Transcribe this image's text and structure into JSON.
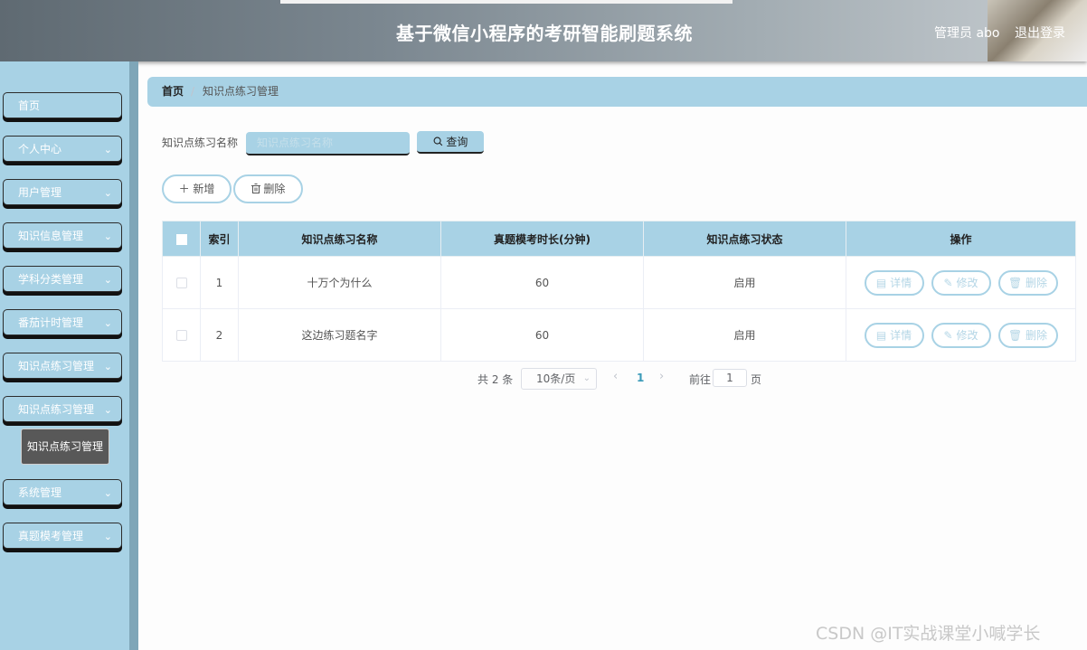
{
  "header": {
    "title": "基于微信小程序的考研智能刷题系统",
    "admin_label": "管理员 abo",
    "logout_label": "退出登录"
  },
  "sidebar": {
    "items": [
      {
        "label": "首页",
        "has_chevron": false
      },
      {
        "label": "个人中心",
        "has_chevron": true
      },
      {
        "label": "用户管理",
        "has_chevron": true
      },
      {
        "label": "知识信息管理",
        "has_chevron": true
      },
      {
        "label": "学科分类管理",
        "has_chevron": true
      },
      {
        "label": "番茄计时管理",
        "has_chevron": true
      },
      {
        "label": "知识点练习管理",
        "has_chevron": true
      },
      {
        "label": "知识点练习管理",
        "has_chevron": true
      },
      {
        "label": "系统管理",
        "has_chevron": true
      },
      {
        "label": "真题模考管理",
        "has_chevron": true
      }
    ],
    "submenu_active": "知识点练习管理"
  },
  "breadcrumb": {
    "home": "首页",
    "separator": "/",
    "current": "知识点练习管理"
  },
  "search": {
    "label": "知识点练习名称",
    "placeholder": "知识点练习名称",
    "value": "",
    "query_label": "查询"
  },
  "actions": {
    "add_label": "新增",
    "delete_label": "删除"
  },
  "table": {
    "columns": [
      "",
      "索引",
      "知识点练习名称",
      "真题模考时长(分钟)",
      "知识点练习状态",
      "操作"
    ],
    "rows": [
      {
        "index": "1",
        "name": "十万个为什么",
        "duration": "60",
        "status": "启用"
      },
      {
        "index": "2",
        "name": "这边练习题名字",
        "duration": "60",
        "status": "启用"
      }
    ],
    "row_actions": {
      "detail": "详情",
      "edit": "修改",
      "delete": "删除"
    }
  },
  "pagination": {
    "total_text": "共 2 条",
    "page_size": "10条/页",
    "current_page": "1",
    "goto_label": "前往",
    "goto_value": "1",
    "page_suffix": "页"
  },
  "watermark": "CSDN @IT实战课堂小喊学长",
  "colors": {
    "accent": "#a8d2e5",
    "header_dark": "#5f6a72",
    "submenu_bg": "#585858",
    "page_active": "#3a9ab8"
  }
}
